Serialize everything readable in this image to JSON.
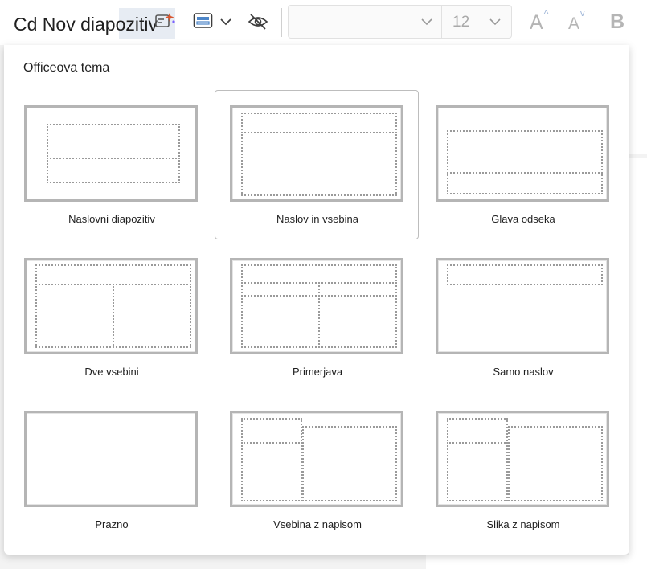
{
  "toolbar": {
    "new_slide_label": "Cd Nov diapozitiv",
    "font_size": "12",
    "grow_font_label": "A",
    "grow_font_arrow": "^",
    "shrink_font_label": "A",
    "shrink_font_arrow": "v",
    "bold_label": "B",
    "icons": [
      "designer-icon",
      "layout-icon",
      "chevron-down-icon",
      "hide-slide-icon"
    ]
  },
  "panel": {
    "theme_title": "Officeova tema",
    "selected_layout": "Naslov in vsebina",
    "layouts": [
      {
        "label": "Naslovni diapozitiv"
      },
      {
        "label": "Naslov in vsebina"
      },
      {
        "label": "Glava odseka"
      },
      {
        "label": "Dve vsebini"
      },
      {
        "label": "Primerjava"
      },
      {
        "label": "Samo naslov"
      },
      {
        "label": "Prazno"
      },
      {
        "label": "Vsebina z napisom"
      },
      {
        "label": "Slika z napisom"
      }
    ]
  },
  "colors": {
    "accent": "#0f6cbd",
    "selection_border": "#bdbdbd",
    "placeholder": "#9a9a9a",
    "disabled_text": "#b5b5b5"
  }
}
